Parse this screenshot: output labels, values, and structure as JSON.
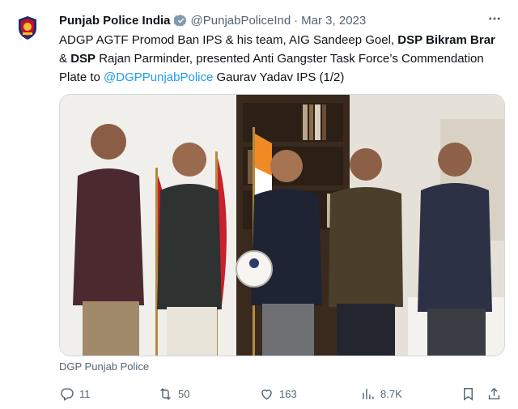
{
  "author": {
    "name": "Punjab Police India",
    "handle": "@PunjabPoliceInd",
    "separator": "·",
    "date": "Mar 3, 2023",
    "verified": true
  },
  "tweet": {
    "text_1": "ADGP AGTF Promod Ban IPS & his team, AIG Sandeep Goel, ",
    "bold_1": "DSP Bikram Brar",
    "text_2": " & ",
    "bold_2": "DSP",
    "text_3": " Rajan Parminder, presented Anti Gangster Task Force’s Commendation Plate to ",
    "mention": "@DGPPunjabPolice",
    "text_4": " Gaurav Yadav IPS (1/2)"
  },
  "media": {
    "caption": "DGP Punjab Police"
  },
  "actions": {
    "replies": "11",
    "retweets": "50",
    "likes": "163",
    "views": "8.7K"
  },
  "colors": {
    "accent": "#1d9bf0",
    "secondary_text": "#536471",
    "primary_text": "#0f1419"
  },
  "icons": [
    "verified-badge-icon",
    "more-icon",
    "reply-icon",
    "retweet-icon",
    "like-icon",
    "views-icon",
    "bookmark-icon",
    "share-icon"
  ]
}
